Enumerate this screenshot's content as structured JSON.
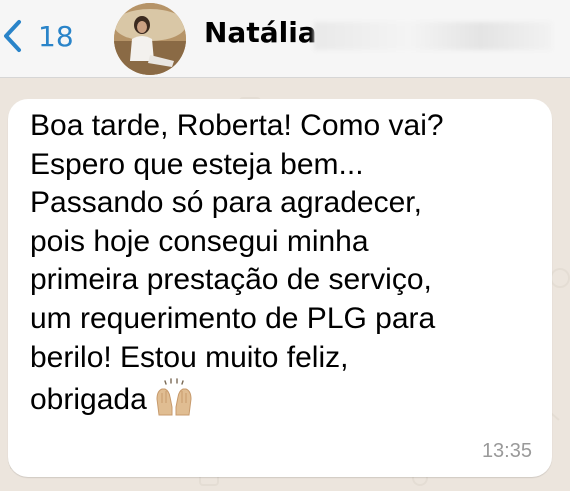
{
  "header": {
    "back_count": "18",
    "contact_name": "Natália"
  },
  "message": {
    "text": "Boa tarde, Roberta! Como vai?\nEspero que esteja bem...\nPassando só para agradecer,\npois hoje consegui minha\nprimeira prestação de serviço,\num requerimento de PLG para\nberilo! Estou muito feliz,\nobrigada",
    "emoji": "raising-hands",
    "time": "13:35"
  },
  "colors": {
    "accent": "#2a84c9",
    "chat_background": "#ece5dd",
    "bubble": "#ffffff"
  }
}
